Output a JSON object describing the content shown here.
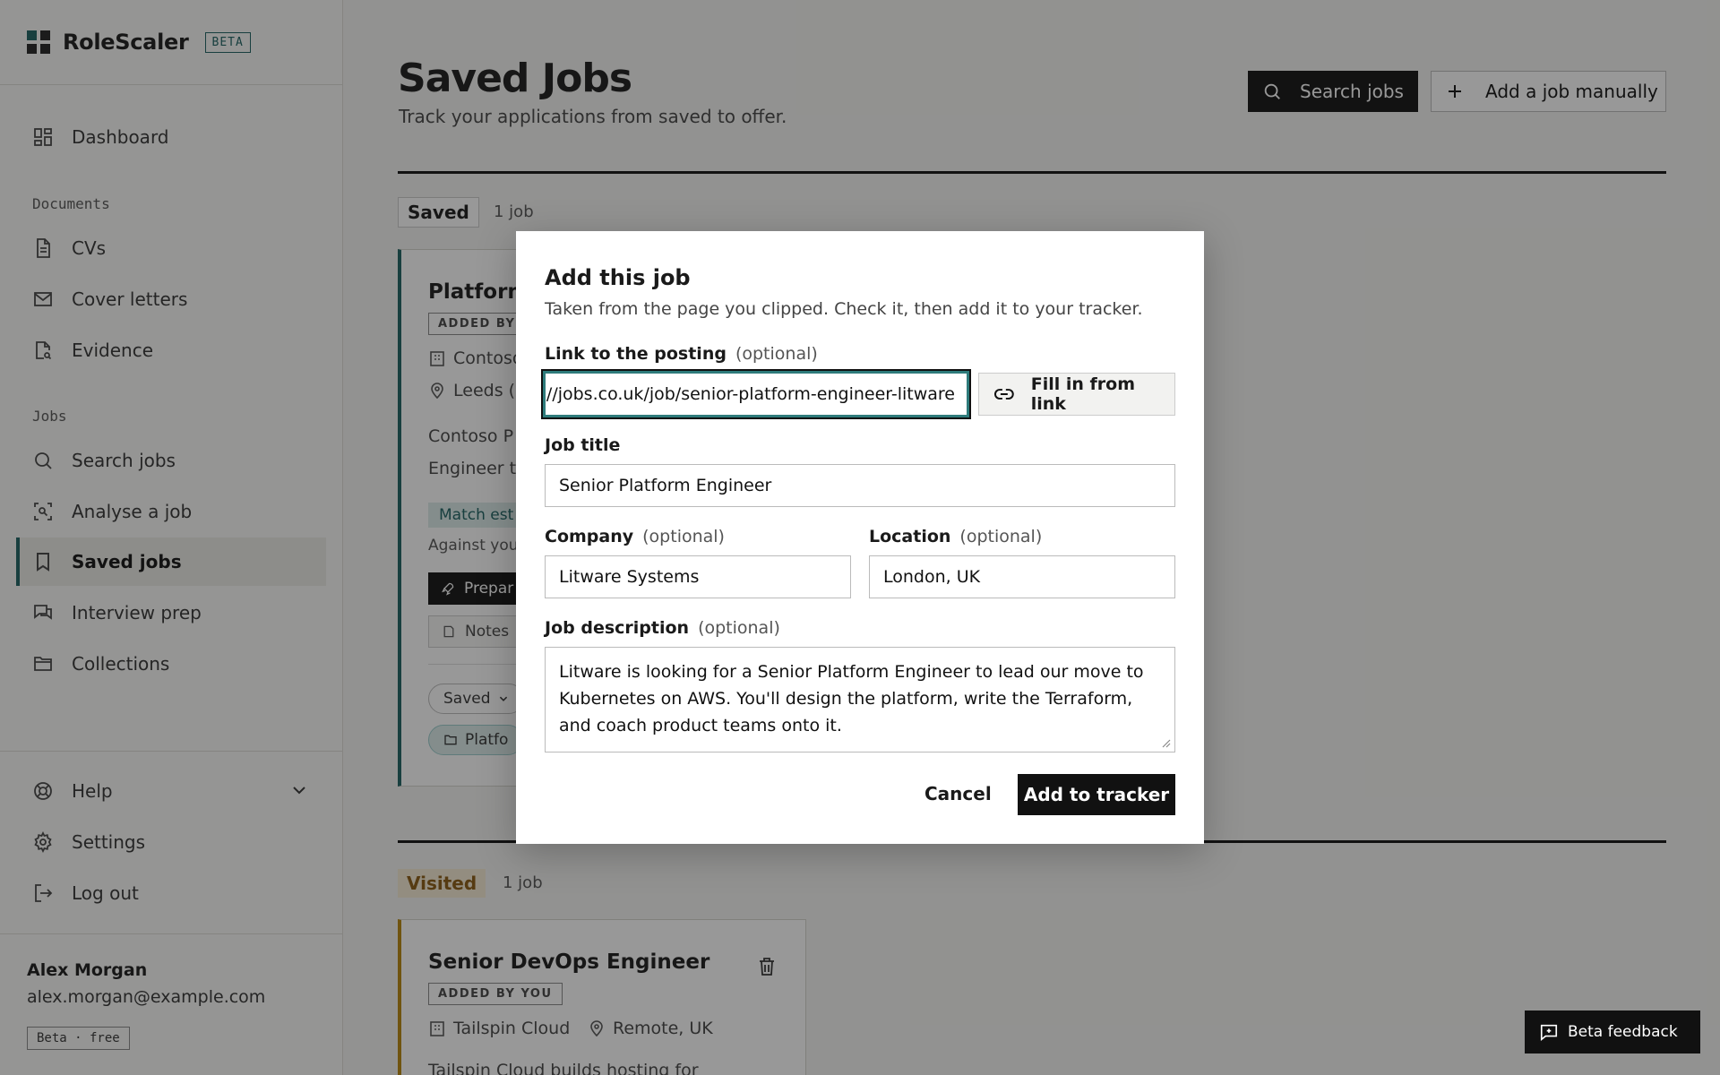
{
  "app": {
    "name": "RoleScaler",
    "beta": "BETA"
  },
  "sidebar": {
    "dashboard": "Dashboard",
    "documents_section": "Documents",
    "cvs": "CVs",
    "cover_letters": "Cover letters",
    "evidence": "Evidence",
    "jobs_section": "Jobs",
    "search_jobs": "Search jobs",
    "analyse_job": "Analyse a job",
    "saved_jobs": "Saved jobs",
    "interview_prep": "Interview prep",
    "collections": "Collections",
    "help": "Help",
    "settings": "Settings",
    "log_out": "Log out",
    "user_name": "Alex Morgan",
    "user_email": "alex.morgan@example.com",
    "plan": "Beta · free"
  },
  "header": {
    "title": "Saved Jobs",
    "subtitle": "Track your applications from saved to offer.",
    "search_button": "Search jobs",
    "add_button": "Add a job manually"
  },
  "saved_section": {
    "label": "Saved",
    "count": "1 job"
  },
  "saved_card": {
    "title": "Platform",
    "badge": "ADDED BY Y",
    "company": "Contoso",
    "location": "Leeds (",
    "desc_line1": "Contoso P",
    "desc_line2": "Engineer t",
    "match": "Match est",
    "against": "Against you",
    "prepare": "Prepar",
    "notes": "Notes",
    "status": "Saved",
    "collection": "Platfo"
  },
  "visited_section": {
    "label": "Visited",
    "count": "1 job"
  },
  "visited_card": {
    "title": "Senior DevOps Engineer",
    "badge": "ADDED BY YOU",
    "company": "Tailspin Cloud",
    "location": "Remote, UK",
    "desc": "Tailspin Cloud builds hosting for"
  },
  "feedback": "Beta feedback",
  "modal": {
    "title": "Add this job",
    "subtitle": "Taken from the page you clipped. Check it, then add it to your tracker.",
    "link_label": "Link to the posting",
    "optional": "(optional)",
    "link_value": "https://jobs.co.uk/job/senior-platform-engineer-litware",
    "fill_button": "Fill in from link",
    "job_title_label": "Job title",
    "job_title_value": "Senior Platform Engineer",
    "company_label": "Company",
    "company_value": "Litware Systems",
    "location_label": "Location",
    "location_value": "London, UK",
    "description_label": "Job description",
    "description_value": "Litware is looking for a Senior Platform Engineer to lead our move to Kubernetes on AWS. You'll design the platform, write the Terraform, and coach product teams onto it.",
    "cancel": "Cancel",
    "submit": "Add to tracker"
  }
}
